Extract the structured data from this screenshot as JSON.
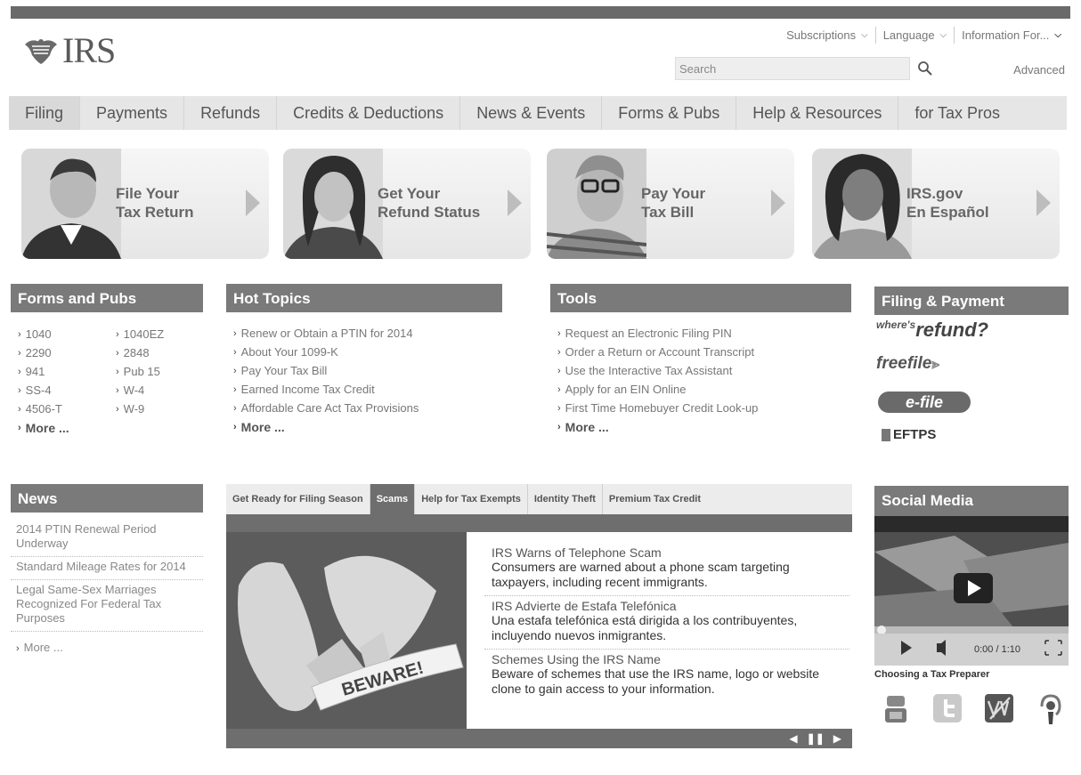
{
  "header": {
    "logo_text": "IRS",
    "util_links": [
      "Subscriptions",
      "Language",
      "Information For..."
    ],
    "search_placeholder": "Search",
    "advanced": "Advanced"
  },
  "nav": [
    "Filing",
    "Payments",
    "Refunds",
    "Credits & Deductions",
    "News & Events",
    "Forms & Pubs",
    "Help & Resources",
    "for Tax Pros"
  ],
  "promos": [
    {
      "line1": "File Your",
      "line2": "Tax Return"
    },
    {
      "line1": "Get Your",
      "line2": "Refund Status"
    },
    {
      "line1": "Pay Your",
      "line2": "Tax Bill"
    },
    {
      "line1": "IRS.gov",
      "line2": "En Español"
    }
  ],
  "forms": {
    "title": "Forms and Pubs",
    "col1": [
      "1040",
      "2290",
      "941",
      "SS-4",
      "4506-T"
    ],
    "col2": [
      "1040EZ",
      "2848",
      "Pub 15",
      "W-4",
      "W-9"
    ],
    "more": "More ..."
  },
  "hot": {
    "title": "Hot Topics",
    "items": [
      "Renew or Obtain a PTIN for 2014",
      "About Your 1099-K",
      "Pay Your Tax Bill",
      "Earned Income Tax Credit",
      "Affordable Care Act Tax Provisions"
    ],
    "more": "More ..."
  },
  "tools": {
    "title": "Tools",
    "items": [
      "Request an Electronic Filing PIN",
      "Order a Return or Account Transcript",
      "Use the Interactive Tax Assistant",
      "Apply for an EIN Online",
      "First Time Homebuyer Credit Look-up"
    ],
    "more": "More ..."
  },
  "filing": {
    "title": "Filing & Payment",
    "wheres": "where's",
    "refund": "refund?",
    "freefile": "freefile",
    "efile": "e-file",
    "eftps": "EFTPS"
  },
  "news": {
    "title": "News",
    "items": [
      "2014 PTIN Renewal Period Underway",
      "Standard Mileage Rates for 2014",
      "Legal Same-Sex Marriages Recognized For Federal Tax Purposes"
    ],
    "more": "More ..."
  },
  "tabs": {
    "labels": [
      "Get Ready for Filing Season",
      "Scams",
      "Help for Tax Exempts",
      "Identity Theft",
      "Premium Tax Credit"
    ],
    "image_text": "BEWARE!",
    "stories": [
      {
        "title": "IRS Warns of Telephone Scam",
        "body": "Consumers are warned about a phone scam targeting taxpayers, including recent immigrants."
      },
      {
        "title": "IRS Advierte de Estafa Telefónica",
        "body": "Una estafa telefónica está dirigida a los contribuyentes, incluyendo nuevos inmigrantes."
      },
      {
        "title": "Schemes Using the IRS Name",
        "body": "Beware of schemes that use the IRS name, logo or website clone to gain access to your information."
      }
    ]
  },
  "social": {
    "title": "Social Media",
    "time": "0:00 / 1:10",
    "caption": "Choosing a Tax Preparer"
  }
}
